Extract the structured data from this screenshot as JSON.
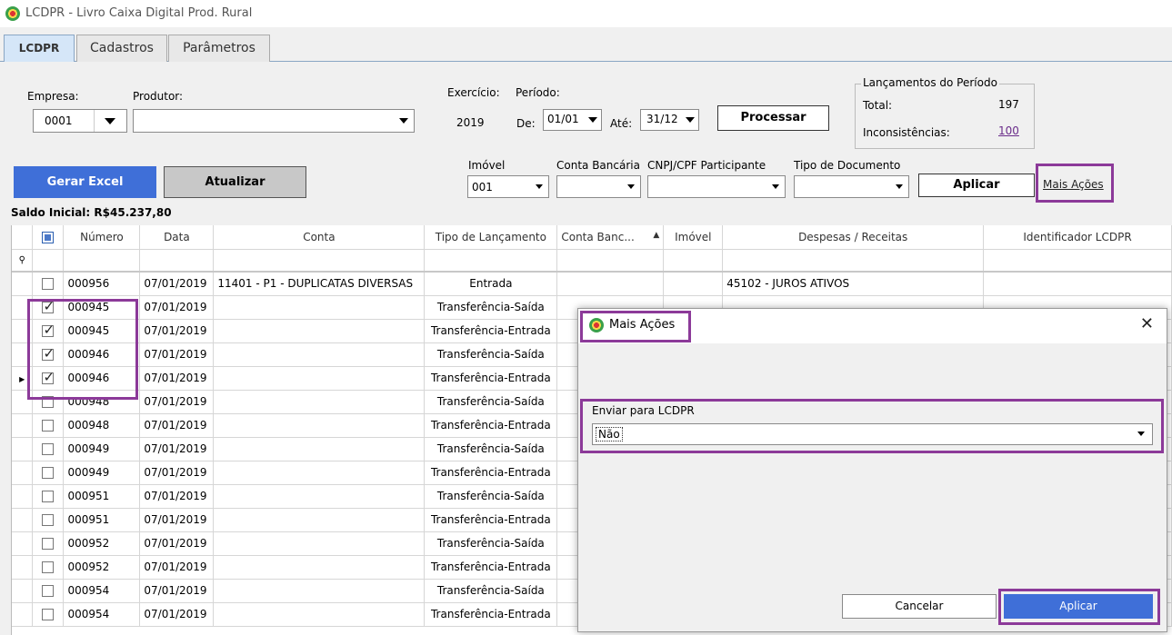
{
  "window": {
    "title": "LCDPR - Livro Caixa Digital Prod. Rural"
  },
  "tabs": [
    "LCDPR",
    "Cadastros",
    "Parâmetros"
  ],
  "form": {
    "empresa_label": "Empresa:",
    "empresa_value": "0001",
    "produtor_label": "Produtor:",
    "produtor_value": "",
    "exercicio_label": "Exercício:",
    "exercicio_value": "2019",
    "periodo_label": "Período:",
    "de_label": "De:",
    "de_value": "01/01",
    "ate_label": "Até:",
    "ate_value": "31/12",
    "processar_label": "Processar"
  },
  "lancamentos": {
    "title": "Lançamentos do Período",
    "total_label": "Total:",
    "total_value": "197",
    "inconsistencias_label": "Inconsistências:",
    "inconsistencias_value": "100"
  },
  "actions": {
    "gerar_excel": "Gerar Excel",
    "atualizar": "Atualizar",
    "aplicar": "Aplicar",
    "mais_acoes": "Mais Ações"
  },
  "filters": {
    "imovel_label": "Imóvel",
    "imovel_value": "001",
    "conta_label": "Conta Bancária",
    "conta_value": "",
    "cnpj_label": "CNPJ/CPF Participante",
    "cnpj_value": "",
    "tipo_doc_label": "Tipo de Documento",
    "tipo_doc_value": ""
  },
  "saldo_inicial": "Saldo Inicial: R$45.237,80",
  "grid": {
    "columns": [
      "Número",
      "Data",
      "Conta",
      "Tipo de Lançamento",
      "Conta Banc...",
      "Imóvel",
      "Despesas / Receitas",
      "Identificador LCDPR"
    ],
    "rows": [
      {
        "checked": false,
        "numero": "000956",
        "data": "07/01/2019",
        "conta": "11401 - P1 - DUPLICATAS DIVERSAS",
        "tipo": "Entrada",
        "despesas": "45102 - JUROS ATIVOS",
        "current": false
      },
      {
        "checked": true,
        "numero": "000945",
        "data": "07/01/2019",
        "conta": "",
        "tipo": "Transferência-Saída",
        "despesas": "",
        "current": false
      },
      {
        "checked": true,
        "numero": "000945",
        "data": "07/01/2019",
        "conta": "",
        "tipo": "Transferência-Entrada",
        "despesas": "",
        "current": false
      },
      {
        "checked": true,
        "numero": "000946",
        "data": "07/01/2019",
        "conta": "",
        "tipo": "Transferência-Saída",
        "despesas": "",
        "current": false
      },
      {
        "checked": true,
        "numero": "000946",
        "data": "07/01/2019",
        "conta": "",
        "tipo": "Transferência-Entrada",
        "despesas": "",
        "current": true
      },
      {
        "checked": false,
        "numero": "000948",
        "data": "07/01/2019",
        "conta": "",
        "tipo": "Transferência-Saída",
        "despesas": "",
        "current": false
      },
      {
        "checked": false,
        "numero": "000948",
        "data": "07/01/2019",
        "conta": "",
        "tipo": "Transferência-Entrada",
        "despesas": "",
        "current": false
      },
      {
        "checked": false,
        "numero": "000949",
        "data": "07/01/2019",
        "conta": "",
        "tipo": "Transferência-Saída",
        "despesas": "",
        "current": false
      },
      {
        "checked": false,
        "numero": "000949",
        "data": "07/01/2019",
        "conta": "",
        "tipo": "Transferência-Entrada",
        "despesas": "",
        "current": false
      },
      {
        "checked": false,
        "numero": "000951",
        "data": "07/01/2019",
        "conta": "",
        "tipo": "Transferência-Saída",
        "despesas": "",
        "current": false
      },
      {
        "checked": false,
        "numero": "000951",
        "data": "07/01/2019",
        "conta": "",
        "tipo": "Transferência-Entrada",
        "despesas": "",
        "current": false
      },
      {
        "checked": false,
        "numero": "000952",
        "data": "07/01/2019",
        "conta": "",
        "tipo": "Transferência-Saída",
        "despesas": "",
        "current": false
      },
      {
        "checked": false,
        "numero": "000952",
        "data": "07/01/2019",
        "conta": "",
        "tipo": "Transferência-Entrada",
        "despesas": "",
        "current": false
      },
      {
        "checked": false,
        "numero": "000954",
        "data": "07/01/2019",
        "conta": "",
        "tipo": "Transferência-Saída",
        "despesas": "",
        "current": false
      },
      {
        "checked": false,
        "numero": "000954",
        "data": "07/01/2019",
        "conta": "",
        "tipo": "Transferência-Entrada",
        "despesas": "",
        "current": false
      }
    ]
  },
  "dialog": {
    "title": "Mais Ações",
    "field_label": "Enviar para LCDPR",
    "field_value": "Não",
    "cancel": "Cancelar",
    "apply": "Aplicar"
  },
  "colors": {
    "accent": "#3f6fd8",
    "highlight": "#8c3a99",
    "link": "#6a2c8a"
  }
}
